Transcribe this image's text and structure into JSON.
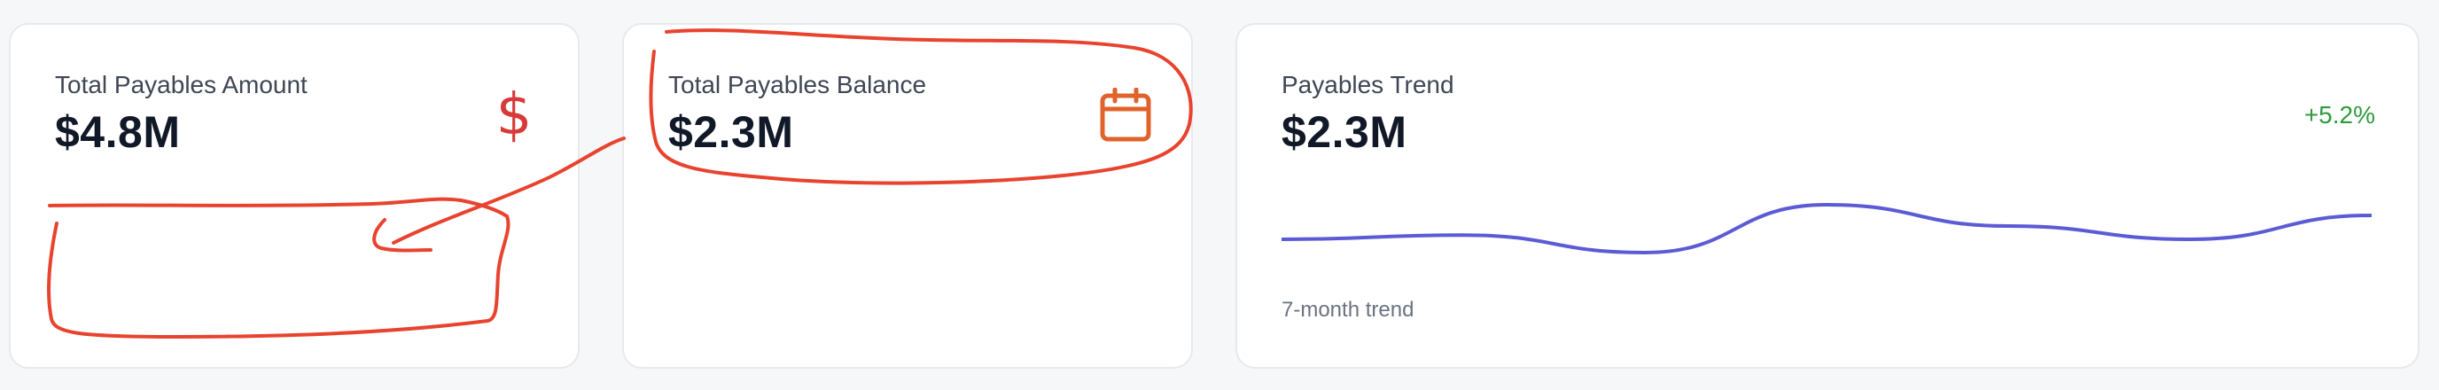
{
  "colors": {
    "background": "#f6f7f9",
    "card": "#ffffff",
    "dollar_icon": "#d83a3a",
    "calendar_icon": "#e0632b",
    "positive_change": "#2e9b3c",
    "trend_line": "#5b5bd6",
    "annotation": "#e8432f"
  },
  "cards": [
    {
      "title": "Total Payables Amount",
      "value": "$4.8M",
      "icon": "dollar-icon"
    },
    {
      "title": "Total Payables Balance",
      "value": "$2.3M",
      "icon": "calendar-icon"
    },
    {
      "title": "Payables Trend",
      "value": "$2.3M",
      "change": "+5.2%",
      "caption": "7-month trend",
      "sparkline": [
        0.3,
        0.38,
        0.05,
        0.95,
        0.55,
        0.3,
        0.75
      ]
    }
  ]
}
